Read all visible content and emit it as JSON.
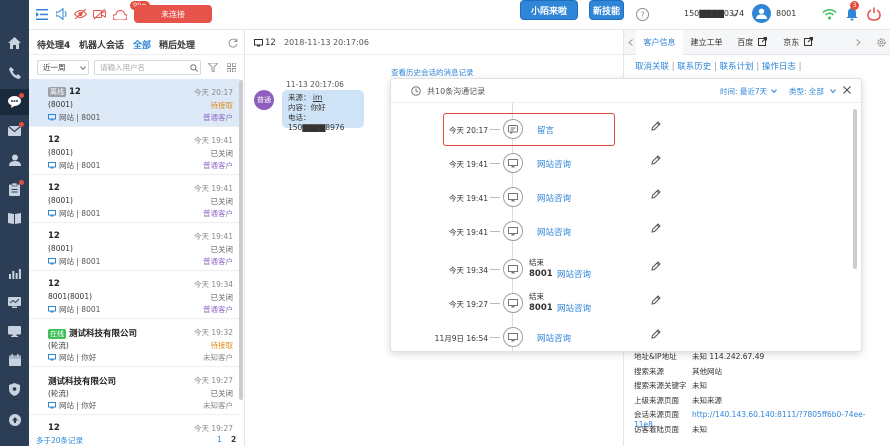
{
  "topbar": {
    "badge": "99+",
    "disconnect_label": "未连接",
    "bubble1": "小陌来啦",
    "bubble2": "新技能",
    "phone_masked": "150▇▇▇▇0374",
    "agent_id": "8001",
    "notif_count": "3"
  },
  "convlist": {
    "tabs": [
      "待处理4",
      "机器人会话",
      "全部",
      "稍后处理"
    ],
    "period": "近一周",
    "search_placeholder": "请输入用户名",
    "items": [
      {
        "tag": "离线",
        "name": "12",
        "sub": "(8001)",
        "source": "网站 | 8001",
        "time": "今天 20:17",
        "status": "待接取",
        "type": "普通客户"
      },
      {
        "tag": "",
        "name": "12",
        "sub": "(8001)",
        "source": "网站 | 8001",
        "time": "今天 19:41",
        "status": "已关闭",
        "type": "普通客户"
      },
      {
        "tag": "",
        "name": "12",
        "sub": "(8001)",
        "source": "网站 | 8001",
        "time": "今天 19:41",
        "status": "已关闭",
        "type": "普通客户"
      },
      {
        "tag": "",
        "name": "12",
        "sub": "(8001)",
        "source": "网站 | 8001",
        "time": "今天 19:41",
        "status": "已关闭",
        "type": "普通客户"
      },
      {
        "tag": "",
        "name": "12",
        "sub": "8001(8001)",
        "source": "网站 | 8001",
        "time": "今天 19:34",
        "status": "已关闭",
        "type": "普通客户"
      },
      {
        "tag": "在线",
        "name": "测试科技有限公司",
        "sub": "(轮流)",
        "source": "网站 | 你好",
        "time": "今天 19:32",
        "status": "待接取",
        "type": "未知客户"
      },
      {
        "tag": "",
        "name": "测试科技有限公司",
        "sub": "(轮流)",
        "source": "网站 | 你好",
        "time": "今天 19:27",
        "status": "已关闭",
        "type": "未知客户"
      },
      {
        "tag": "",
        "name": "12",
        "sub": "",
        "source": "",
        "time": "今天 19:27",
        "status": "",
        "type": ""
      }
    ],
    "footer_text": "多于20条记录",
    "page1": "1",
    "page2": "2"
  },
  "chat": {
    "title": "12",
    "datetime": "2018-11-13 20:17:06",
    "history_link": "查看历史会话的消息记录",
    "msg_time": "11-13 20:17:06",
    "avatar_label": "普通",
    "msg_lines": [
      "来源：",
      "内容：",
      "电话："
    ],
    "msg_values": [
      "im",
      "你好",
      "150▇▇▇▇8976"
    ]
  },
  "popup": {
    "summary": "共10条沟通记录",
    "time_filter": "时间: 最近7天",
    "type_filter": "类型: 全部",
    "records": [
      {
        "time": "今天 20:17",
        "icon": "message-icon",
        "label": "留言",
        "end": "",
        "end_id": ""
      },
      {
        "time": "今天 19:41",
        "icon": "monitor-icon",
        "label": "网站咨询",
        "end": "",
        "end_id": ""
      },
      {
        "time": "今天 19:41",
        "icon": "monitor-icon",
        "label": "网站咨询",
        "end": "",
        "end_id": ""
      },
      {
        "time": "今天 19:41",
        "icon": "monitor-icon",
        "label": "网站咨询",
        "end": "",
        "end_id": ""
      },
      {
        "time": "今天 19:34",
        "icon": "monitor-icon",
        "label": "网站咨询",
        "end": "结束",
        "end_id": "8001"
      },
      {
        "time": "今天 19:27",
        "icon": "monitor-icon",
        "label": "网站咨询",
        "end": "结束",
        "end_id": "8001"
      },
      {
        "time": "11月9日 16:54",
        "icon": "monitor-icon",
        "label": "网站咨询",
        "end": "",
        "end_id": ""
      }
    ]
  },
  "right": {
    "tabs": [
      "客户信息",
      "建立工单",
      "百度",
      "京东"
    ],
    "links": [
      "取消关联",
      "联系历史",
      "联系计划",
      "操作日志"
    ],
    "info": [
      {
        "k": "地址&IP地址",
        "v": "未知 114.242.67.49"
      },
      {
        "k": "搜索来源",
        "v": "其他网站"
      },
      {
        "k": "搜索来源关键字",
        "v": "未知"
      },
      {
        "k": "上级来源页面",
        "v": "未知来源"
      },
      {
        "k": "会话来源页面",
        "v": "http://140.143.60.140:8111/?7805ff6b0-74ee-11e8..."
      },
      {
        "k": "访客着陆页面",
        "v": "未知"
      }
    ]
  },
  "colors": {
    "accent": "#2f86d8",
    "danger": "#e5534b",
    "sidebar": "#2c3e55"
  }
}
